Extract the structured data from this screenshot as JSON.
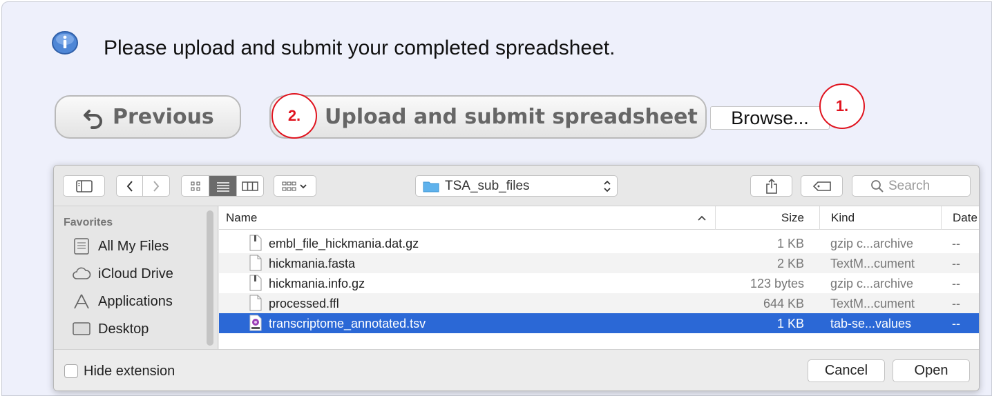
{
  "message": "Please upload and submit your completed spreadsheet.",
  "buttons": {
    "previous": "Previous",
    "upload": "Upload and submit spreadsheet",
    "browse": "Browse..."
  },
  "callouts": [
    "1.",
    "2."
  ],
  "dialog": {
    "location": "TSA_sub_files",
    "search_placeholder": "Search",
    "sidebar": {
      "heading": "Favorites",
      "items": [
        {
          "label": "All My Files",
          "icon": "all-files-icon"
        },
        {
          "label": "iCloud Drive",
          "icon": "cloud-icon"
        },
        {
          "label": "Applications",
          "icon": "applications-icon"
        },
        {
          "label": "Desktop",
          "icon": "desktop-icon"
        }
      ]
    },
    "columns": {
      "name": "Name",
      "size": "Size",
      "kind": "Kind",
      "date": "Date"
    },
    "files": [
      {
        "name": "embl_file_hickmania.dat.gz",
        "size": "1 KB",
        "kind": "gzip c...archive",
        "date": "--",
        "icon": "archive-icon"
      },
      {
        "name": "hickmania.fasta",
        "size": "2 KB",
        "kind": "TextM...cument",
        "date": "--",
        "icon": "document-icon"
      },
      {
        "name": "hickmania.info.gz",
        "size": "123 bytes",
        "kind": "gzip c...archive",
        "date": "--",
        "icon": "archive-icon"
      },
      {
        "name": "processed.ffl",
        "size": "644 KB",
        "kind": "TextM...cument",
        "date": "--",
        "icon": "document-icon"
      },
      {
        "name": "transcriptome_annotated.tsv",
        "size": "1 KB",
        "kind": "tab-se...values",
        "date": "--",
        "icon": "tsv-icon",
        "selected": true
      }
    ],
    "hide_extension": "Hide extension",
    "cancel": "Cancel",
    "open": "Open"
  },
  "colors": {
    "selection": "#2b68d6",
    "callout": "#e0141f",
    "panel": "#eef0fb"
  }
}
